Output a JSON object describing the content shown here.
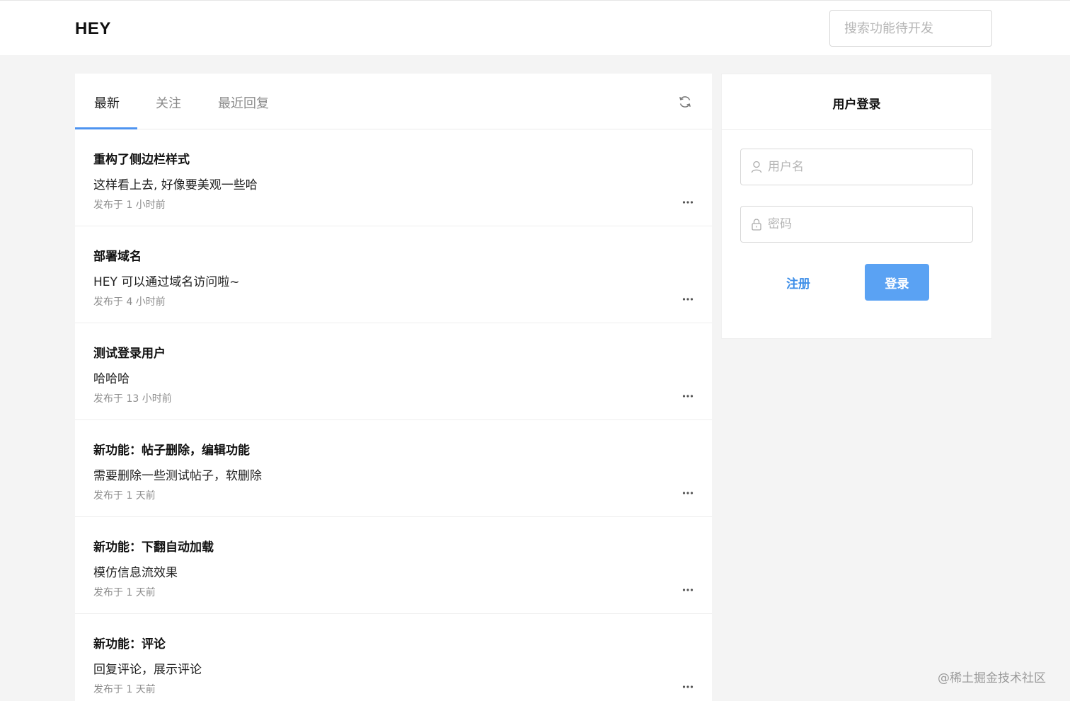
{
  "header": {
    "logo": "HEY",
    "search_placeholder": "搜索功能待开发"
  },
  "tabs": [
    {
      "label": "最新",
      "active": true
    },
    {
      "label": "关注",
      "active": false
    },
    {
      "label": "最近回复",
      "active": false
    }
  ],
  "posts": [
    {
      "title": "重构了侧边栏样式",
      "body": "这样看上去, 好像要美观一些哈",
      "meta": "发布于 1 小时前"
    },
    {
      "title": "部署域名",
      "body": "HEY 可以通过域名访问啦~",
      "meta": "发布于 4 小时前"
    },
    {
      "title": "测试登录用户",
      "body": "哈哈哈",
      "meta": "发布于 13 小时前"
    },
    {
      "title": "新功能：帖子删除，编辑功能",
      "body": "需要删除一些测试帖子，软删除",
      "meta": "发布于 1 天前"
    },
    {
      "title": "新功能：下翻自动加载",
      "body": "模仿信息流效果",
      "meta": "发布于 1 天前"
    },
    {
      "title": "新功能：评论",
      "body": "回复评论，展示评论",
      "meta": "发布于 1 天前"
    }
  ],
  "login": {
    "title": "用户登录",
    "username_placeholder": "用户名",
    "password_placeholder": "密码",
    "register_label": "注册",
    "login_label": "登录"
  },
  "watermark": "@稀土掘金技术社区",
  "colors": {
    "accent": "#4e94f0",
    "login_button": "#5aa2f3",
    "link": "#3d8ee8",
    "background": "#f4f4f4"
  }
}
